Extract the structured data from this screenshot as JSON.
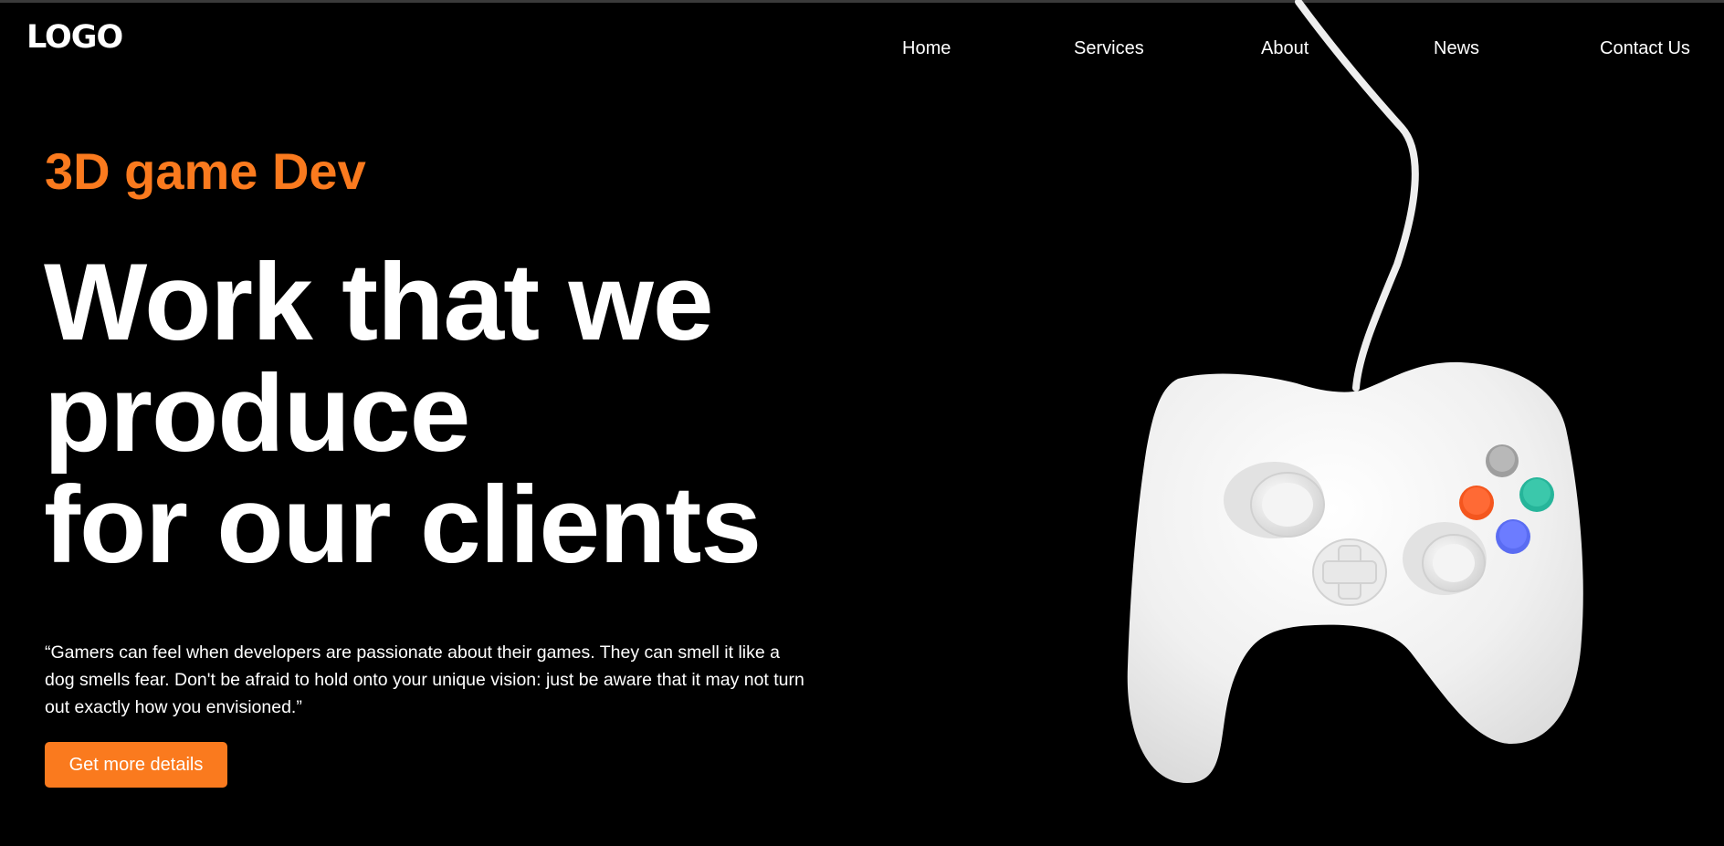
{
  "brand": {
    "logo_text": "LOGO"
  },
  "nav": {
    "items": [
      {
        "label": "Home"
      },
      {
        "label": "Services"
      },
      {
        "label": "About"
      },
      {
        "label": "News"
      },
      {
        "label": "Contact Us"
      }
    ]
  },
  "hero": {
    "eyebrow": "3D game Dev",
    "headline_lines": [
      "Work that we",
      "produce",
      "for our clients"
    ],
    "quote": "“Gamers can feel when developers are passionate about their games. They can smell it like a dog smells fear. Don't be afraid to hold onto your unique vision: just be aware that it may not turn out exactly how you envisioned.”",
    "cta_label": "Get more details",
    "image_icon": "game-controller-icon"
  },
  "colors": {
    "background": "#000000",
    "accent": "#fa7a1e",
    "text": "#ffffff",
    "controller_body": "#f2f2f2",
    "button_gray": "#9e9e9e",
    "button_teal": "#26b59a",
    "button_orange": "#f4561e",
    "button_blue": "#5a6cf2"
  }
}
